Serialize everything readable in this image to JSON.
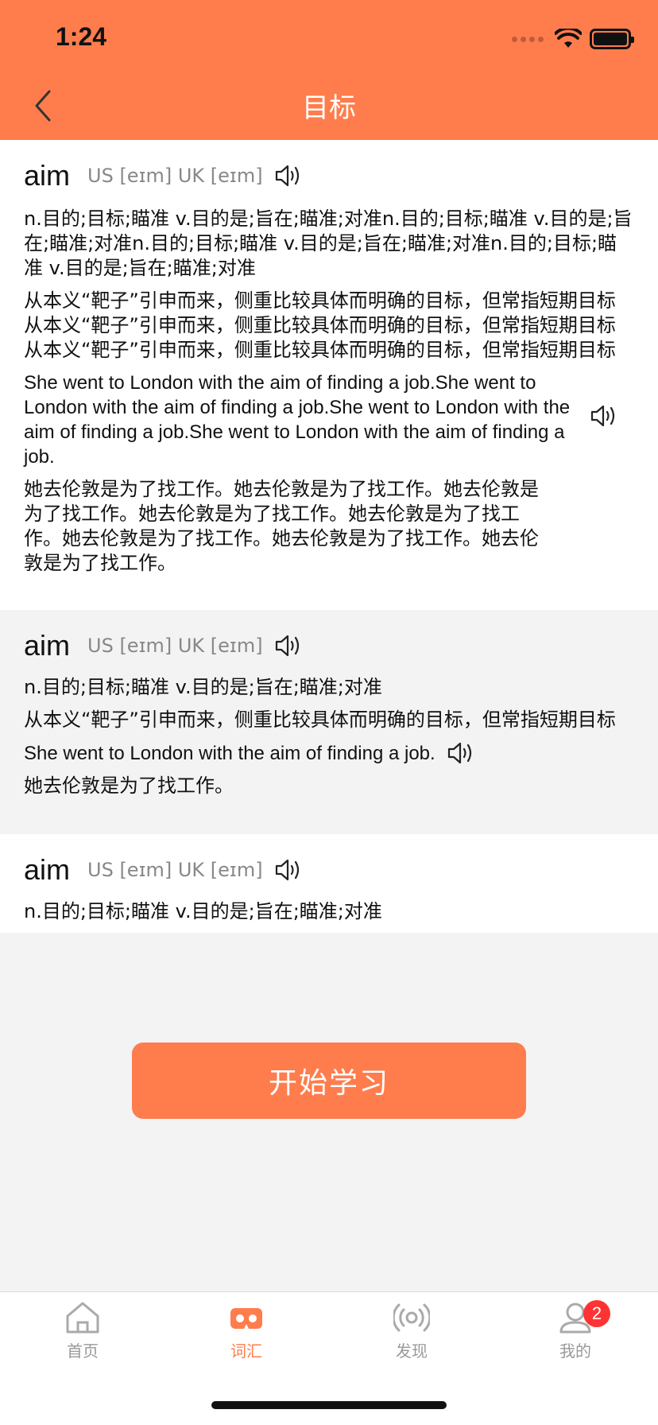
{
  "status": {
    "time": "1:24"
  },
  "nav": {
    "title": "目标"
  },
  "cards": [
    {
      "word": "aim",
      "phonetic": "US [eɪm] UK [eɪm]",
      "definition": "n.目的;目标;瞄准 v.目的是;旨在;瞄准;对准n.目的;目标;瞄准 v.目的是;旨在;瞄准;对准n.目的;目标;瞄准 v.目的是;旨在;瞄准;对准n.目的;目标;瞄准 v.目的是;旨在;瞄准;对准",
      "explanation": "从本义“靶子”引申而来，侧重比较具体而明确的目标，但常指短期目标从本义“靶子”引申而来，侧重比较具体而明确的目标，但常指短期目标从本义“靶子”引申而来，侧重比较具体而明确的目标，但常指短期目标",
      "example": "She went to London with the aim of finding a job.She went to London with the aim of finding a job.She went to London with the aim of finding a job.She went to London with the aim of finding a job.",
      "translation": "她去伦敦是为了找工作。她去伦敦是为了找工作。她去伦敦是为了找工作。她去伦敦是为了找工作。她去伦敦是为了找工作。她去伦敦是为了找工作。她去伦敦是为了找工作。她去伦敦是为了找工作。"
    },
    {
      "word": "aim",
      "phonetic": "US [eɪm] UK [eɪm]",
      "definition": "n.目的;目标;瞄准 v.目的是;旨在;瞄准;对准",
      "explanation": "从本义“靶子”引申而来，侧重比较具体而明确的目标，但常指短期目标",
      "example": "She went to London with the aim of finding a job.",
      "translation": "她去伦敦是为了找工作。"
    },
    {
      "word": "aim",
      "phonetic": "US [eɪm] UK [eɪm]",
      "definition": "n.目的;目标;瞄准 v.目的是;旨在;瞄准;对准"
    }
  ],
  "start_button": "开始学习",
  "tabs": [
    {
      "label": "首页",
      "icon": "home-icon"
    },
    {
      "label": "词汇",
      "icon": "vocab-icon",
      "active": true
    },
    {
      "label": "发现",
      "icon": "discover-icon"
    },
    {
      "label": "我的",
      "icon": "profile-icon",
      "badge": "2"
    }
  ],
  "colors": {
    "accent": "#ff7d4d",
    "badge": "#ff3333"
  }
}
